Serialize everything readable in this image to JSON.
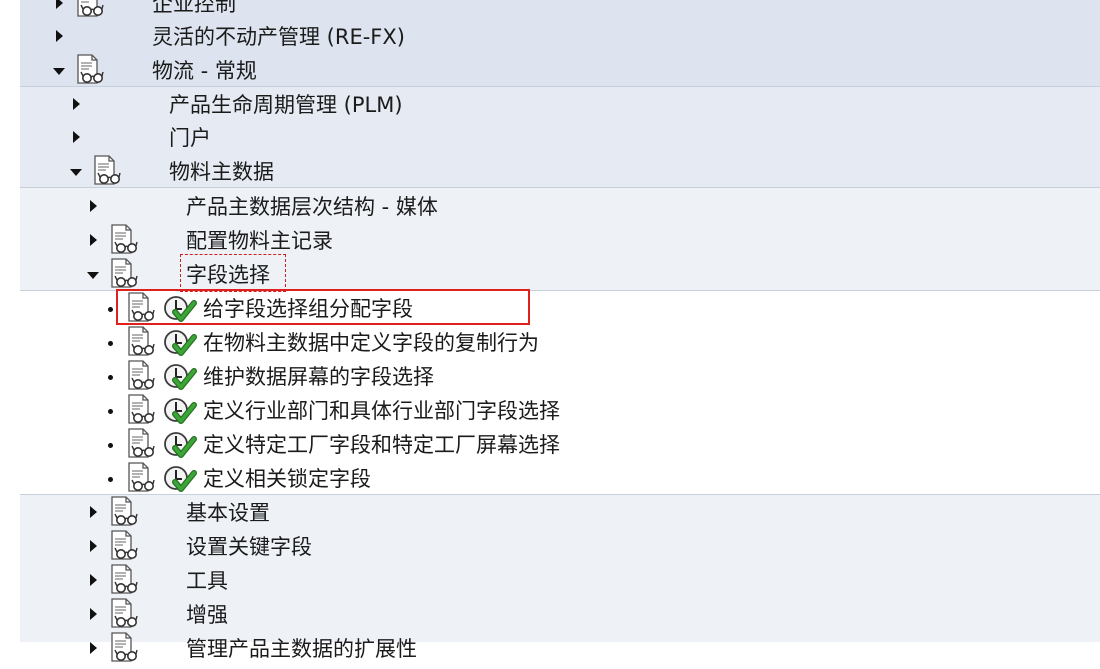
{
  "tree": {
    "nodes": [
      {
        "label": "企业控制",
        "state": "collapsed",
        "doc": true,
        "exec": false
      },
      {
        "label": "灵活的不动产管理 (RE-FX)",
        "state": "collapsed",
        "doc": false,
        "exec": false
      },
      {
        "label": "物流 - 常规",
        "state": "expanded",
        "doc": true,
        "exec": false
      },
      {
        "label": "产品生命周期管理 (PLM)",
        "state": "collapsed",
        "doc": false,
        "exec": false
      },
      {
        "label": "门户",
        "state": "collapsed",
        "doc": false,
        "exec": false
      },
      {
        "label": "物料主数据",
        "state": "expanded",
        "doc": true,
        "exec": false
      },
      {
        "label": "产品主数据层次结构 - 媒体",
        "state": "collapsed",
        "doc": false,
        "exec": false
      },
      {
        "label": "配置物料主记录",
        "state": "collapsed",
        "doc": true,
        "exec": false
      },
      {
        "label": "字段选择",
        "state": "expanded",
        "doc": true,
        "exec": false
      },
      {
        "label": "给字段选择组分配字段",
        "state": "leaf",
        "doc": true,
        "exec": true
      },
      {
        "label": "在物料主数据中定义字段的复制行为",
        "state": "leaf",
        "doc": true,
        "exec": true
      },
      {
        "label": "维护数据屏幕的字段选择",
        "state": "leaf",
        "doc": true,
        "exec": true
      },
      {
        "label": "定义行业部门和具体行业部门字段选择",
        "state": "leaf",
        "doc": true,
        "exec": true
      },
      {
        "label": "定义特定工厂字段和特定工厂屏幕选择",
        "state": "leaf",
        "doc": true,
        "exec": true
      },
      {
        "label": "定义相关锁定字段",
        "state": "leaf",
        "doc": true,
        "exec": true
      },
      {
        "label": "基本设置",
        "state": "collapsed",
        "doc": true,
        "exec": false
      },
      {
        "label": "设置关键字段",
        "state": "collapsed",
        "doc": true,
        "exec": false
      },
      {
        "label": "工具",
        "state": "collapsed",
        "doc": true,
        "exec": false
      },
      {
        "label": "增强",
        "state": "collapsed",
        "doc": true,
        "exec": false
      },
      {
        "label": "管理产品主数据的扩展性",
        "state": "collapsed",
        "doc": true,
        "exec": false
      }
    ]
  },
  "colors": {
    "highlight": "#e0201c",
    "check_green": "#3aa635"
  }
}
